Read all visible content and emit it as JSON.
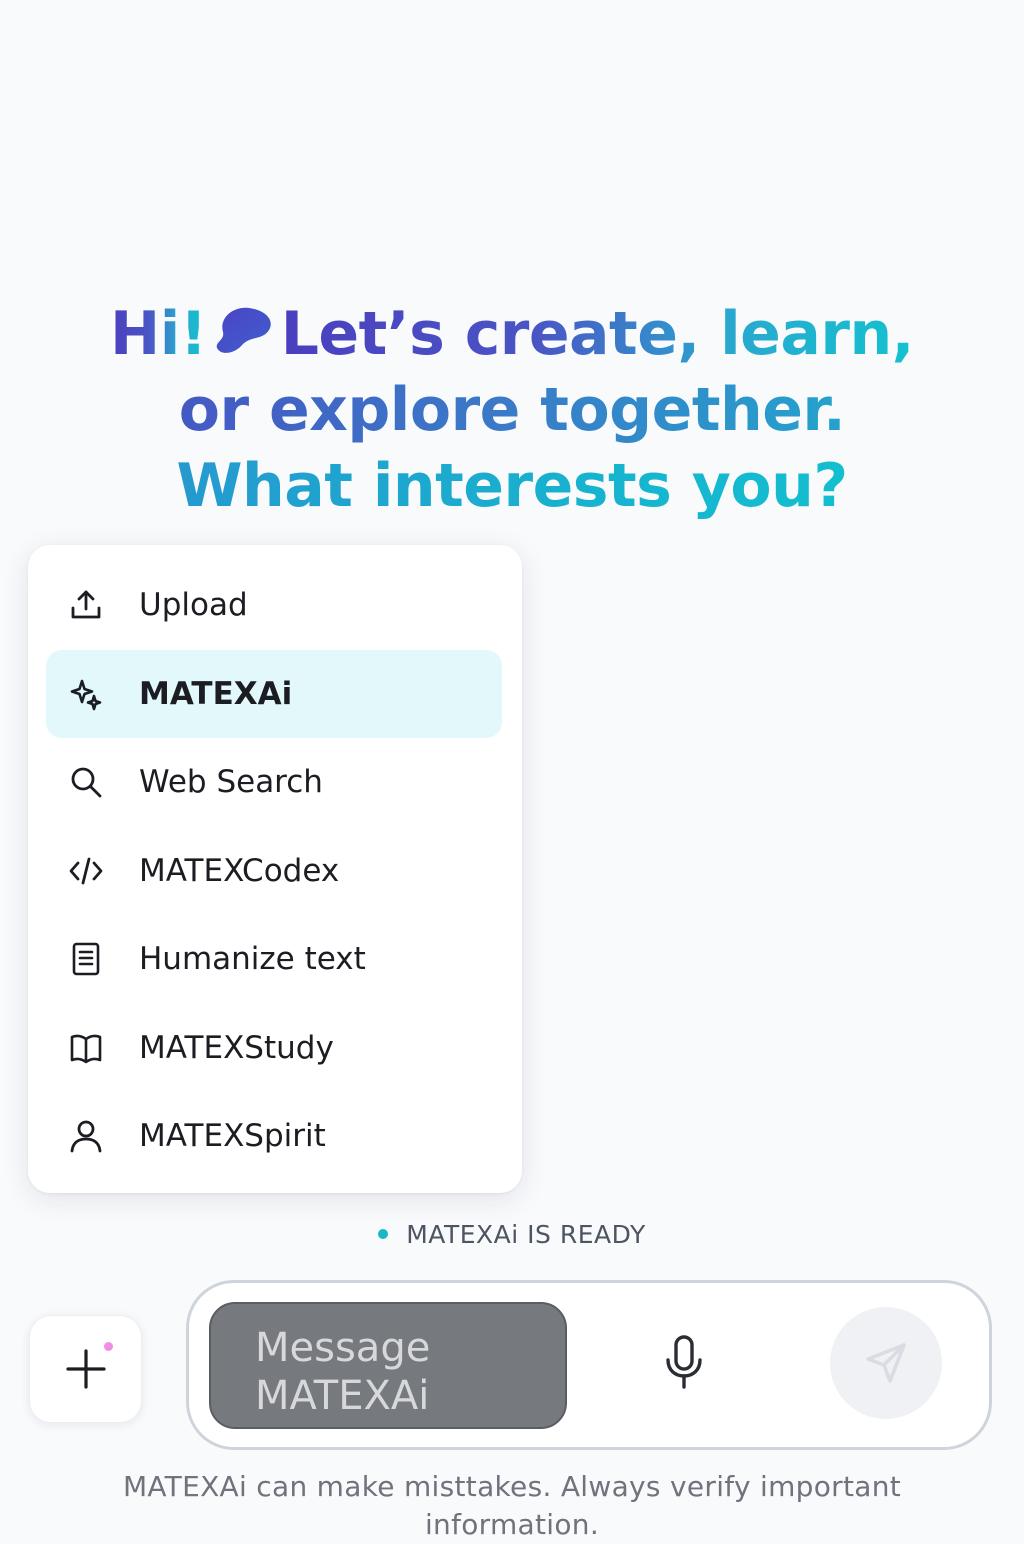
{
  "greeting": {
    "hi": "Hi!",
    "rest_line1": "Let’s create, learn,",
    "line2": "or explore together.",
    "line3": "What interests you?",
    "blob_icon": "blob-icon",
    "gradient_colors": [
      "#4a3fbf",
      "#2aa7cf",
      "#12c2cf"
    ]
  },
  "menu": {
    "items": [
      {
        "label": "Upload",
        "icon": "upload-icon",
        "active": false
      },
      {
        "label": "MATEXAi",
        "icon": "sparkles-icon",
        "active": true
      },
      {
        "label": "Web Search",
        "icon": "search-icon",
        "active": false
      },
      {
        "label": "MATEXCodex",
        "icon": "code-icon",
        "active": false
      },
      {
        "label": "Humanize text",
        "icon": "document-icon",
        "active": false
      },
      {
        "label": "MATEXStudy",
        "icon": "book-icon",
        "active": false
      },
      {
        "label": "MATEXSpirit",
        "icon": "user-icon",
        "active": false
      }
    ],
    "active_color": "#e2f8fb"
  },
  "status": {
    "text": "MATEXAi IS READY",
    "dot_color": "#1cb7c4"
  },
  "composer": {
    "placeholder": "Message MATEXAi",
    "plus_icon": "plus-icon",
    "mic_icon": "microphone-icon",
    "send_icon": "send-icon",
    "notification_dot_color": "#f08de6"
  },
  "disclaimer": {
    "line1": "MATEXAi can make misttakes. Always verify important",
    "line2": "information."
  }
}
